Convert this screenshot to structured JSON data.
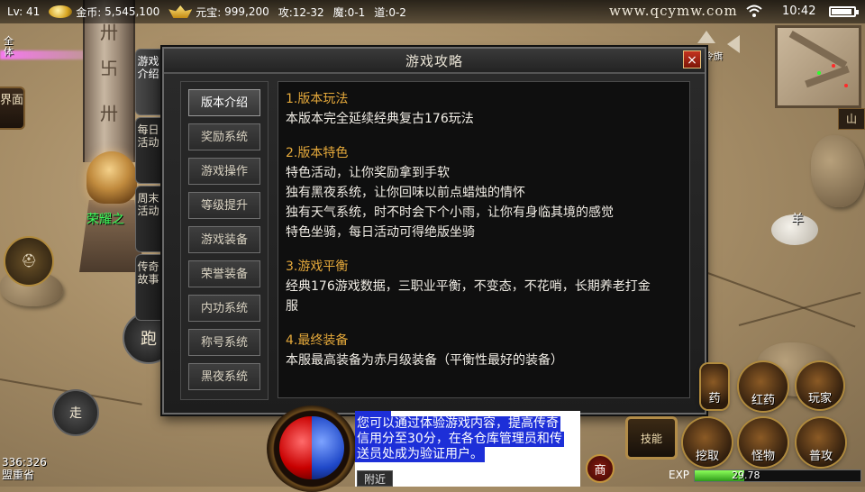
{
  "status": {
    "level": "Lv: 41",
    "gold_label": "金币:",
    "gold_value": "5,545,100",
    "yuanbao_label": "元宝:",
    "yuanbao_value": "999,200",
    "attack": "攻:12-32",
    "magic": "魔:0-1",
    "tao": "道:0-2",
    "site": "www.qcymw.com",
    "time": "10:42"
  },
  "world": {
    "side_label": "全体",
    "npc_name": "荣耀之",
    "monster_name": "羊",
    "jiemian": "界面",
    "run": "跑",
    "walk": "走",
    "coords": "336:326",
    "map_name": "盟重省",
    "minimap_btn": "山",
    "top_icon_label": "令旗"
  },
  "tabs": [
    "游戏介绍",
    "每日活动",
    "周末活动",
    "传奇故事"
  ],
  "panel": {
    "title": "游戏攻略",
    "close": "×",
    "menu": [
      "版本介绍",
      "奖励系统",
      "游戏操作",
      "等级提升",
      "游戏装备",
      "荣誉装备",
      "内功系统",
      "称号系统",
      "黑夜系统"
    ],
    "sections": [
      {
        "title": "1.版本玩法",
        "lines": [
          "本版本完全延续经典复古176玩法"
        ]
      },
      {
        "title": "2.版本特色",
        "lines": [
          "特色活动，让你奖励拿到手软",
          "独有黑夜系统，让你回味以前点蜡烛的情怀",
          "独有天气系统，时不时会下个小雨，让你有身临其境的感觉",
          "特色坐骑，每日活动可得绝版坐骑"
        ]
      },
      {
        "title": "3.游戏平衡",
        "lines": [
          "经典176游戏数据，三职业平衡，不变态，不花哨，长期养老打金",
          "服"
        ]
      },
      {
        "title": "4.最终装备",
        "lines": [
          "本服最高装备为赤月级装备（平衡性最好的装备）"
        ]
      }
    ]
  },
  "chat": {
    "lines": [
      "您可以通过体验游戏内容，提高传奇",
      "信用分至30分，在各仓库管理员和传",
      "送员处成为验证用户。"
    ],
    "tab": "附近"
  },
  "buttons": {
    "shop": "商",
    "skill": "技能",
    "potion_a": "药",
    "potion_b": "红药",
    "player": "玩家",
    "dig": "挖取",
    "monster": "怪物",
    "attack_mode": "普攻"
  },
  "exp": {
    "label": "EXP",
    "value": "29.78",
    "percent": 29.78
  },
  "colors": {
    "section_title": "#e5a93b",
    "npc_name": "#39ff5a",
    "chat_highlight": "#1d2fd8",
    "close": "#c3331f"
  },
  "icons": [
    "coin-icon",
    "ingot-icon",
    "wifi-icon",
    "battery-icon",
    "close-icon",
    "helmet-icon",
    "minimap-icon"
  ]
}
